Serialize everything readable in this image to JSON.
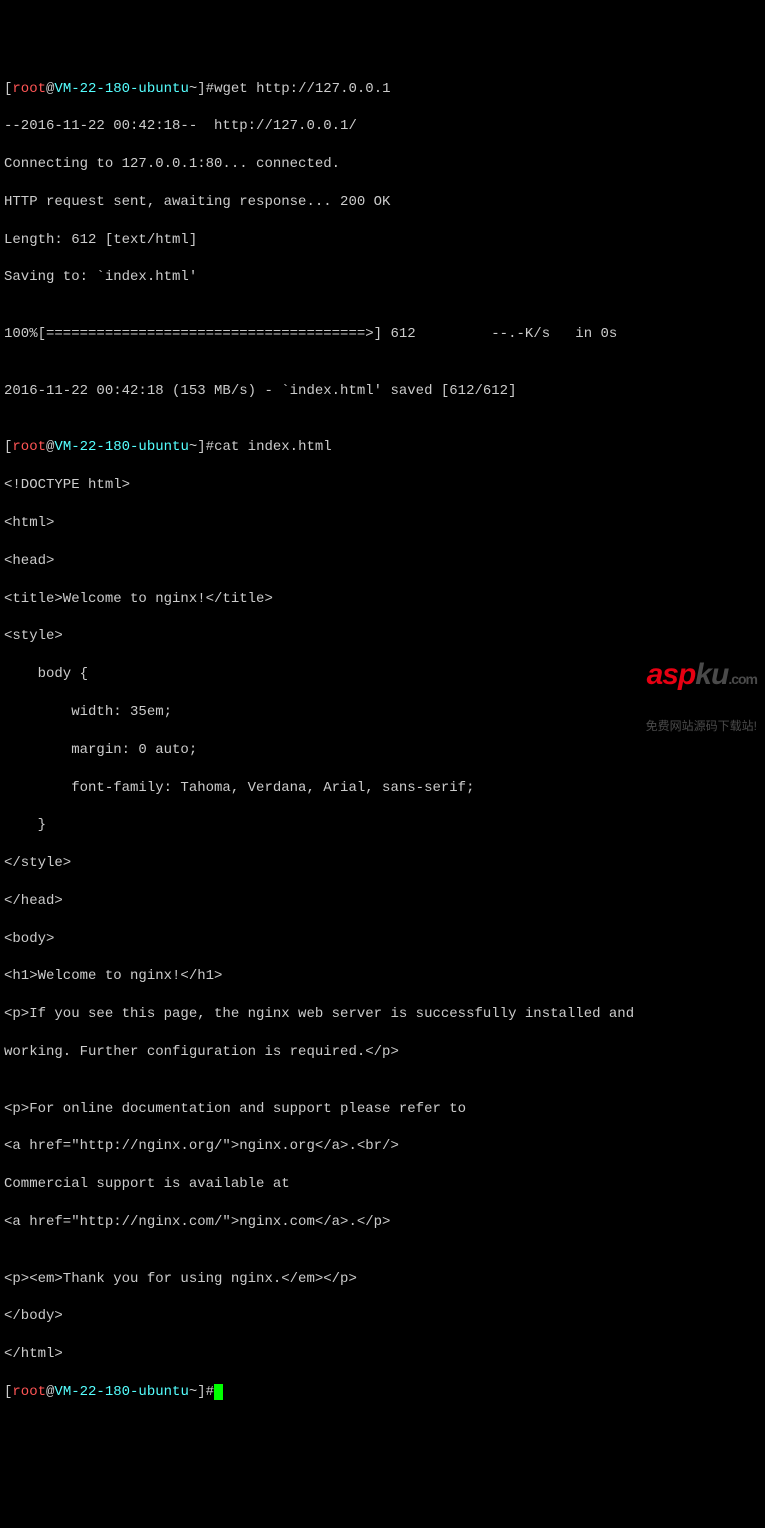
{
  "prompt": {
    "user": "root",
    "host": "VM-22-180-ubuntu",
    "path": "~",
    "open": "[",
    "at": "@",
    "close": "]#"
  },
  "commands": {
    "cmd1": "wget http://127.0.0.1",
    "cmd2": "cat index.html",
    "cmd3": ""
  },
  "wget_output": {
    "l1": "--2016-11-22 00:42:18--  http://127.0.0.1/",
    "l2": "Connecting to 127.0.0.1:80... connected.",
    "l3": "HTTP request sent, awaiting response... 200 OK",
    "l4": "Length: 612 [text/html]",
    "l5": "Saving to: `index.html'",
    "l6": "",
    "l7": "100%[======================================>] 612         --.-K/s   in 0s",
    "l8": "",
    "l9": "2016-11-22 00:42:18 (153 MB/s) - `index.html' saved [612/612]",
    "l10": ""
  },
  "cat_output": {
    "l1": "<!DOCTYPE html>",
    "l2": "<html>",
    "l3": "<head>",
    "l4": "<title>Welcome to nginx!</title>",
    "l5": "<style>",
    "l6": "    body {",
    "l7": "        width: 35em;",
    "l8": "        margin: 0 auto;",
    "l9": "        font-family: Tahoma, Verdana, Arial, sans-serif;",
    "l10": "    }",
    "l11": "</style>",
    "l12": "</head>",
    "l13": "<body>",
    "l14": "<h1>Welcome to nginx!</h1>",
    "l15": "<p>If you see this page, the nginx web server is successfully installed and",
    "l16": "working. Further configuration is required.</p>",
    "l17": "",
    "l18": "<p>For online documentation and support please refer to",
    "l19": "<a href=\"http://nginx.org/\">nginx.org</a>.<br/>",
    "l20": "Commercial support is available at",
    "l21": "<a href=\"http://nginx.com/\">nginx.com</a>.</p>",
    "l22": "",
    "l23": "<p><em>Thank you for using nginx.</em></p>",
    "l24": "</body>",
    "l25": "</html>"
  },
  "watermark": {
    "brand_red": "asp",
    "brand_black": "ku",
    "brand_com": ".com",
    "tagline": "免费网站源码下载站!"
  }
}
